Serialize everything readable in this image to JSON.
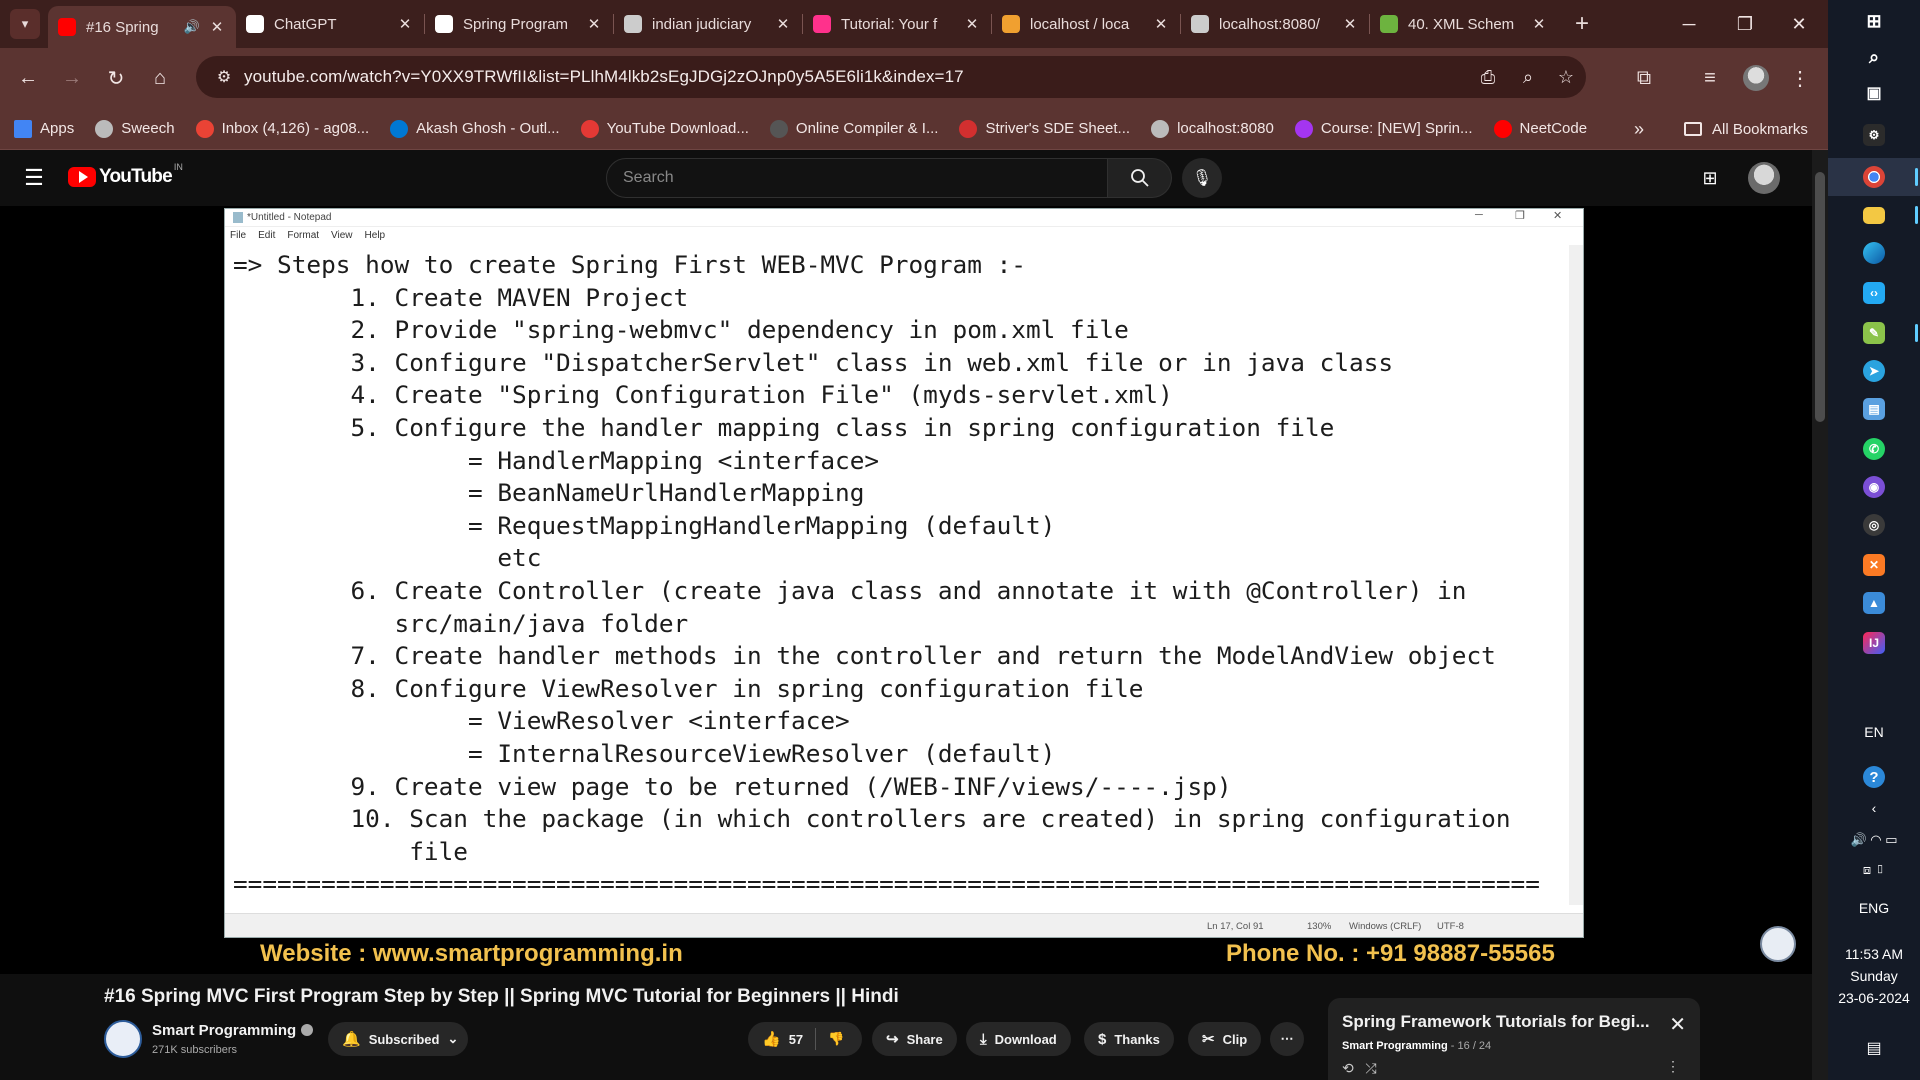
{
  "browser": {
    "tabs": [
      {
        "title": "#16 Spring",
        "active": true,
        "icon": "youtube-icon",
        "color": "#ff0000"
      },
      {
        "title": "ChatGPT",
        "icon": "chatgpt-icon",
        "color": "#ffffff"
      },
      {
        "title": "Spring Program",
        "icon": "chatgpt-icon",
        "color": "#ffffff"
      },
      {
        "title": "indian judiciary",
        "icon": "globe-icon",
        "color": "#cccccc"
      },
      {
        "title": "Tutorial: Your f",
        "icon": "jetbrains-icon",
        "color": "#ff318c"
      },
      {
        "title": "localhost / loca",
        "icon": "phpmyadmin-icon",
        "color": "#f0a030"
      },
      {
        "title": "localhost:8080/",
        "icon": "globe-icon",
        "color": "#cccccc"
      },
      {
        "title": "40. XML Schem",
        "icon": "spring-icon",
        "color": "#6db33f"
      }
    ],
    "url": "youtube.com/watch?v=Y0XX9TRWfII&list=PLlhM4lkb2sEgJDGj2zOJnp0y5A5E6li1k&index=17",
    "bookmarks": [
      {
        "label": "Apps",
        "icon": "apps-grid-icon",
        "color": "#4285f4"
      },
      {
        "label": "Sweech",
        "icon": "globe-icon",
        "color": "#bbbbbb"
      },
      {
        "label": "Inbox (4,126) - ag08...",
        "icon": "gmail-icon",
        "color": "#ea4335"
      },
      {
        "label": "Akash Ghosh - Outl...",
        "icon": "outlook-icon",
        "color": "#0078d4"
      },
      {
        "label": "YouTube Download...",
        "icon": "download-icon",
        "color": "#e53935"
      },
      {
        "label": "Online Compiler & I...",
        "icon": "code-icon",
        "color": "#555555"
      },
      {
        "label": "Striver's SDE Sheet...",
        "icon": "tuf-icon",
        "color": "#d32f2f"
      },
      {
        "label": "localhost:8080",
        "icon": "globe-icon",
        "color": "#bbbbbb"
      },
      {
        "label": "Course: [NEW] Sprin...",
        "icon": "udemy-icon",
        "color": "#a435f0"
      },
      {
        "label": "NeetCode",
        "icon": "neetcode-icon",
        "color": "#ff0000"
      }
    ],
    "all_bookmarks": "All Bookmarks"
  },
  "youtube": {
    "logo": "YouTube",
    "country": "IN",
    "search_placeholder": "Search",
    "notepad": {
      "title": "*Untitled - Notepad",
      "menu": [
        "File",
        "Edit",
        "Format",
        "View",
        "Help"
      ],
      "lines": [
        "=> Steps how to create Spring First WEB-MVC Program :-",
        "        1. Create MAVEN Project",
        "        2. Provide \"spring-webmvc\" dependency in pom.xml file",
        "        3. Configure \"DispatcherServlet\" class in web.xml file or in java class",
        "        4. Create \"Spring Configuration File\" (myds-servlet.xml)",
        "        5. Configure the handler mapping class in spring configuration file",
        "                = HandlerMapping <interface>",
        "                = BeanNameUrlHandlerMapping",
        "                = RequestMappingHandlerMapping (default)",
        "                  etc",
        "        6. Create Controller (create java class and annotate it with @Controller) in",
        "           src/main/java folder",
        "        7. Create handler methods in the controller and return the ModelAndView object",
        "        8. Configure ViewResolver in spring configuration file",
        "                = ViewResolver <interface>",
        "                = InternalResourceViewResolver (default)",
        "        9. Create view page to be returned (/WEB-INF/views/----.jsp)",
        "        10. Scan the package (in which controllers are created) in spring configuration",
        "            file",
        "========================================================================================="
      ],
      "status": {
        "position": "Ln 17, Col 91",
        "zoom": "130%",
        "eol": "Windows (CRLF)",
        "encoding": "UTF-8"
      }
    },
    "overlay_website": "Website : www.smartprogramming.in",
    "overlay_phone": "Phone No. : +91 98887-55565",
    "video_title": "#16 Spring MVC First Program Step by Step || Spring MVC Tutorial for Beginners || Hindi",
    "channel": {
      "name": "Smart Programming",
      "subscribers": "271K subscribers"
    },
    "actions": {
      "subscribed": "Subscribed",
      "likes": "57",
      "share": "Share",
      "download": "Download",
      "thanks": "Thanks",
      "clip": "Clip"
    },
    "playlist": {
      "title": "Spring Framework Tutorials for Begi...",
      "channel": "Smart Programming",
      "position": "16 / 24"
    }
  },
  "taskbar": {
    "lang": "EN",
    "input": "ENG",
    "time": "11:53 AM",
    "day": "Sunday",
    "date": "23-06-2024"
  },
  "colors": {
    "tab_bg": "#3c1f1d",
    "toolbar_bg": "#5b3431",
    "yt_bg": "#0f0f0f",
    "overlay_text": "#f2c14e",
    "taskbar_bg": "#141a26"
  }
}
